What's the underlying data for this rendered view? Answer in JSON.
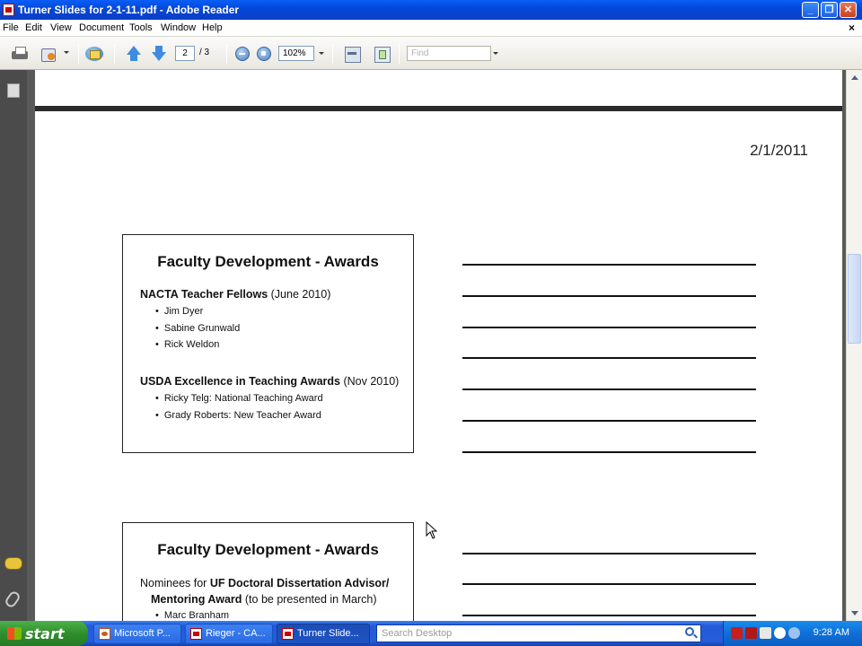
{
  "window": {
    "title": "Turner Slides for 2-1-11.pdf - Adobe Reader"
  },
  "menu": {
    "items": [
      "File",
      "Edit",
      "View",
      "Document",
      "Tools",
      "Window",
      "Help"
    ],
    "close_glyph": "×"
  },
  "toolbar": {
    "page_current": "2",
    "page_total": "/ 3",
    "zoom": "102%",
    "find_placeholder": "Find"
  },
  "page": {
    "date": "2/1/2011",
    "slides": [
      {
        "title": "Faculty Development - Awards",
        "sections": [
          {
            "heading": "NACTA Teacher Fellows",
            "note": " (June 2010)",
            "items": [
              "Jim Dyer",
              "Sabine Grunwald",
              "Rick Weldon"
            ]
          },
          {
            "heading": "USDA Excellence in Teaching Awards",
            "note": " (Nov 2010)",
            "items": [
              "Ricky Telg: National Teaching Award",
              "Grady Roberts: New Teacher Award"
            ]
          }
        ]
      },
      {
        "title": "Faculty Development - Awards",
        "line1_prefix": "Nominees for ",
        "line1_bold": "UF Doctoral Dissertation Advisor/",
        "line2_bold": "Mentoring Award",
        "line2_note": " (to be presented in March)",
        "items": [
          "Marc Branham"
        ]
      }
    ]
  },
  "taskbar": {
    "start_label": "start",
    "tasks": [
      "Microsoft P...",
      "Rieger - CA...",
      "Turner Slide..."
    ],
    "search_placeholder": "Search Desktop",
    "clock": "9:28 AM"
  }
}
